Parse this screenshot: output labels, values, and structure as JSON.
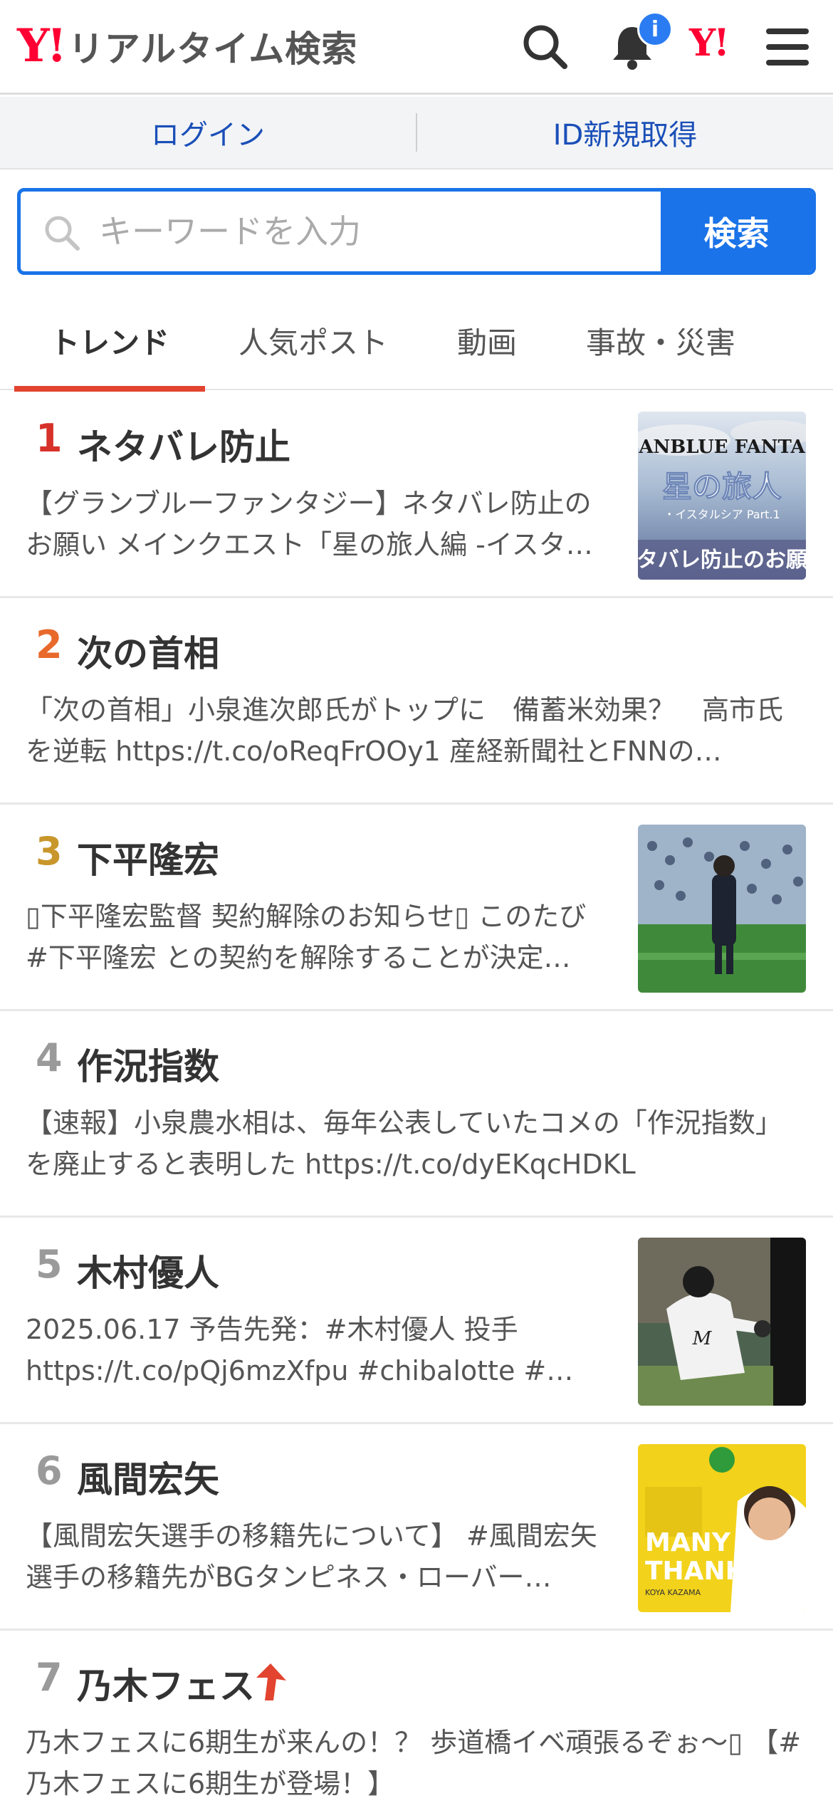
{
  "header": {
    "logo_mark": "Y!",
    "logo_text": "リアルタイム検索",
    "notification_badge": "i",
    "yahoo_mark": "Y!"
  },
  "login_bar": {
    "login": "ログイン",
    "register": "ID新規取得"
  },
  "search": {
    "placeholder": "キーワードを入力",
    "button": "検索"
  },
  "tabs": [
    {
      "label": "トレンド",
      "active": true
    },
    {
      "label": "人気ポスト",
      "active": false
    },
    {
      "label": "動画",
      "active": false
    },
    {
      "label": "事故・災害",
      "active": false
    }
  ],
  "colors": {
    "accent_blue": "#1a73e8",
    "brand_red": "#ff0033",
    "rank1": "#d6322a",
    "rank2": "#e8692b",
    "rank3": "#c8962a",
    "rank_gray": "#9a9a9a"
  },
  "trends": [
    {
      "rank": "1",
      "title": "ネタバレ防止",
      "desc": "【グランブルーファンタジー】ネタバレ防止のお願い メインクエスト「星の旅人編 -イスタ…",
      "thumb": "granblue-fantasy-banner"
    },
    {
      "rank": "2",
      "title": "次の首相",
      "desc": "「次の首相」小泉進次郎氏がトップに　備蓄米効果？　高市氏を逆転 https://t.co/oReqFrOOy1 産経新聞社とFNNの…",
      "thumb": null
    },
    {
      "rank": "3",
      "title": "下平隆宏",
      "desc": "▯下平隆宏監督 契約解除のお知らせ▯ このたび #下平隆宏 との契約を解除することが決定…",
      "thumb": "soccer-coach-photo"
    },
    {
      "rank": "4",
      "title": "作況指数",
      "desc": "【速報】小泉農水相は、毎年公表していたコメの「作況指数」を廃止すると表明した https://t.co/dyEKqcHDKL",
      "thumb": null
    },
    {
      "rank": "5",
      "title": "木村優人",
      "desc": "2025.06.17 予告先発：#木村優人 投手 https://t.co/pQj6mzXfpu #chibalotte #…",
      "thumb": "baseball-pitcher-photo"
    },
    {
      "rank": "6",
      "title": "風間宏矢",
      "desc": "【風間宏矢選手の移籍先について】 #風間宏矢 選手の移籍先がBGタンピネス・ローバー…",
      "thumb": "many-thanks-banner"
    },
    {
      "rank": "7",
      "title": "乃木フェス",
      "desc": "乃木フェスに6期生が来んの！？ 歩道橋イベ頑張るぞぉ〜▯ 【#乃木フェスに6期生が登場！】",
      "thumb": null,
      "rising": true
    }
  ],
  "thumb_text": {
    "t1_line1": "ANBLUE FANTA",
    "t1_line2": "星の旅人",
    "t1_line3": "・イスタルシア Part.1",
    "t1_line4": "タバレ防止のお願",
    "t6_line1": "MANY",
    "t6_line2": "THANKS",
    "t6_line3": "KOYA KAZAMA"
  }
}
